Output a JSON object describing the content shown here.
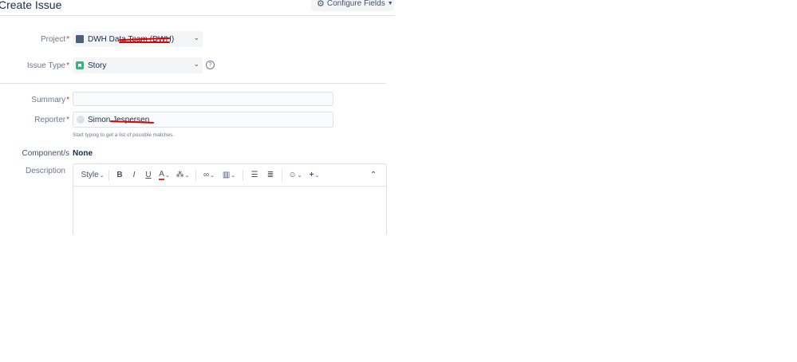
{
  "dialog": {
    "title": "Create Issue",
    "configure_fields_label": "Configure Fields"
  },
  "fields": {
    "project": {
      "label": "Project",
      "required_mark": "*",
      "value": "DWH Data Team (DWH)"
    },
    "issue_type": {
      "label": "Issue Type",
      "required_mark": "*",
      "value": "Story"
    },
    "summary": {
      "label": "Summary",
      "required_mark": "*",
      "value": ""
    },
    "reporter": {
      "label": "Reporter",
      "required_mark": "*",
      "value": "Simon Jespersen",
      "hint": "Start typing to get a list of possible matches."
    },
    "components": {
      "label": "Component/s",
      "value": "None"
    },
    "description": {
      "label": "Description"
    }
  },
  "toolbar": {
    "style_label": "Style",
    "bold": "B",
    "italic": "I",
    "underline": "U",
    "text_color": "A"
  },
  "colors": {
    "required": "#de350b",
    "story": "#36b37e",
    "redaction": "#e00000"
  }
}
